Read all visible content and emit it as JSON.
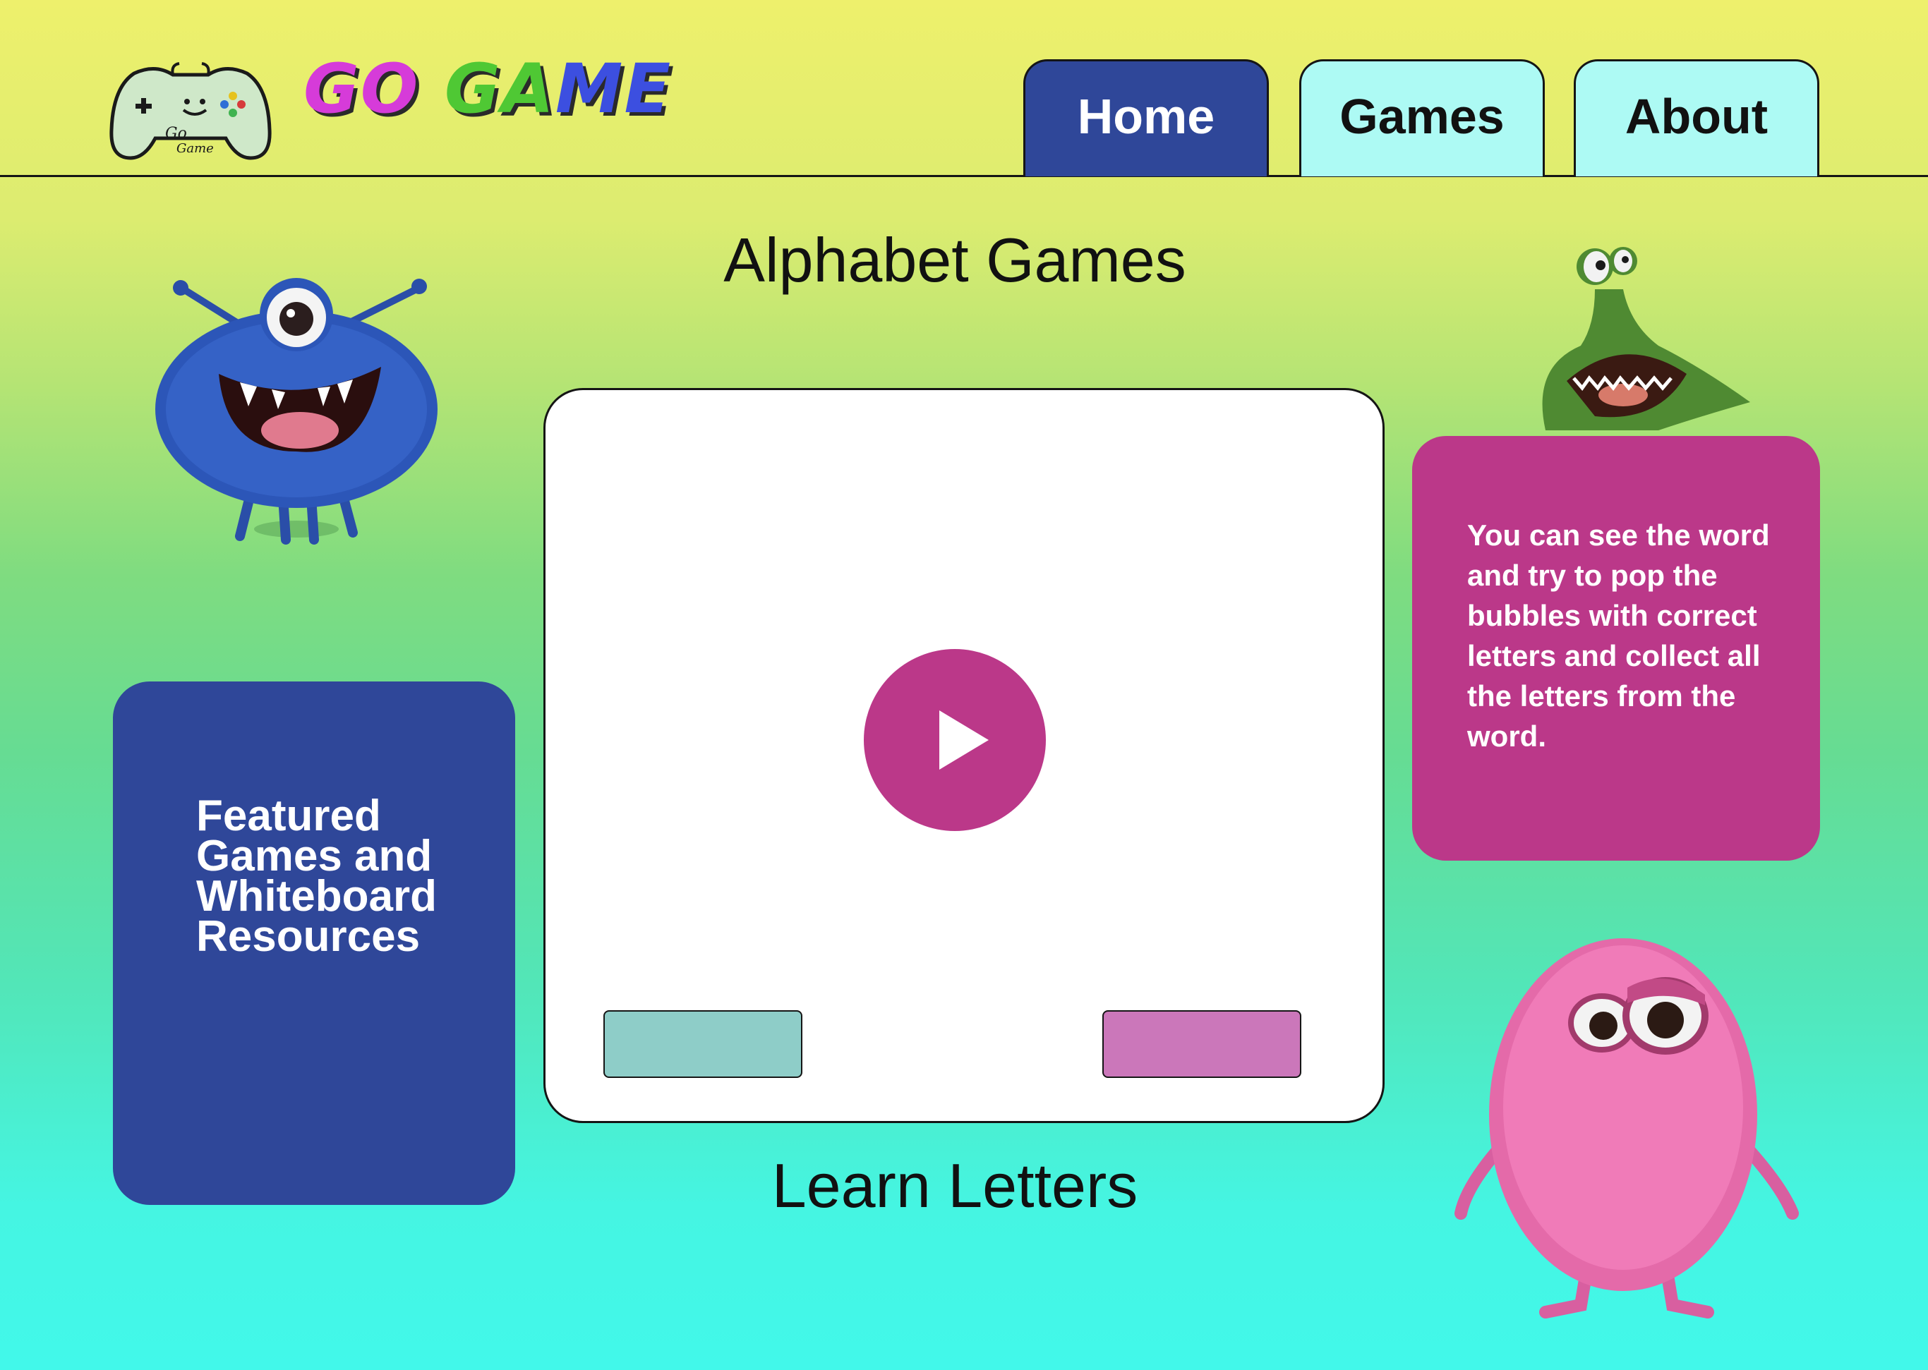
{
  "brand": {
    "name_part1": "GO",
    "name_part2": "GA",
    "name_part3": "ME",
    "logo_text_1": "Go",
    "logo_text_2": "Game"
  },
  "nav": {
    "home": "Home",
    "games": "Games",
    "about": "About"
  },
  "main": {
    "title": "Alphabet Games",
    "subtitle": "Learn Letters",
    "featured_text": "Featured Games and Whiteboard Resources",
    "info_text": "You can see the word and try to pop the bubbles with correct letters and collect all the letters from the word."
  },
  "colors": {
    "nav_active": "#2f4799",
    "nav_inactive": "#adfaf4",
    "accent_magenta": "#bb3889",
    "featured_card": "#2f4799",
    "button_teal": "#8ecdc8",
    "button_pink": "#cb77ba"
  },
  "icons": {
    "logo": "gamepad-icon",
    "play": "play-icon"
  }
}
